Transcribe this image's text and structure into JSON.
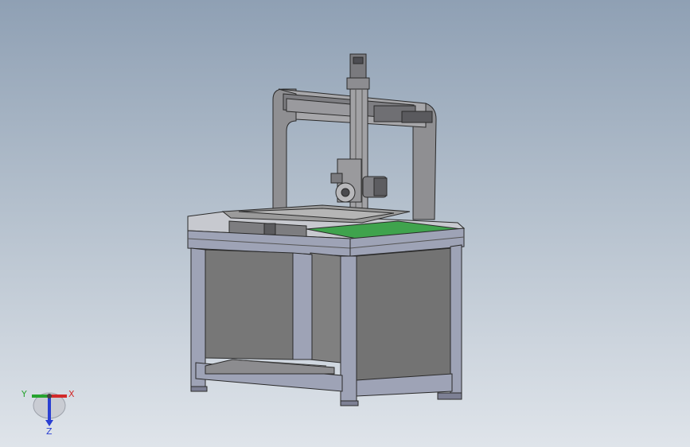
{
  "viewport": {
    "background_top": "#8fa0b4",
    "background_bottom": "#dfe4ea"
  },
  "model": {
    "frame_color": "#9ea3b6",
    "panel_color": "#737373",
    "plate_color": "#b3b3b3",
    "accent_green": "#3fa34d"
  },
  "triad": {
    "x_label": "X",
    "y_label": "Y",
    "z_label": "Z",
    "x_color": "#d22a2a",
    "y_color": "#27a32f",
    "z_color": "#2a3fd2"
  }
}
